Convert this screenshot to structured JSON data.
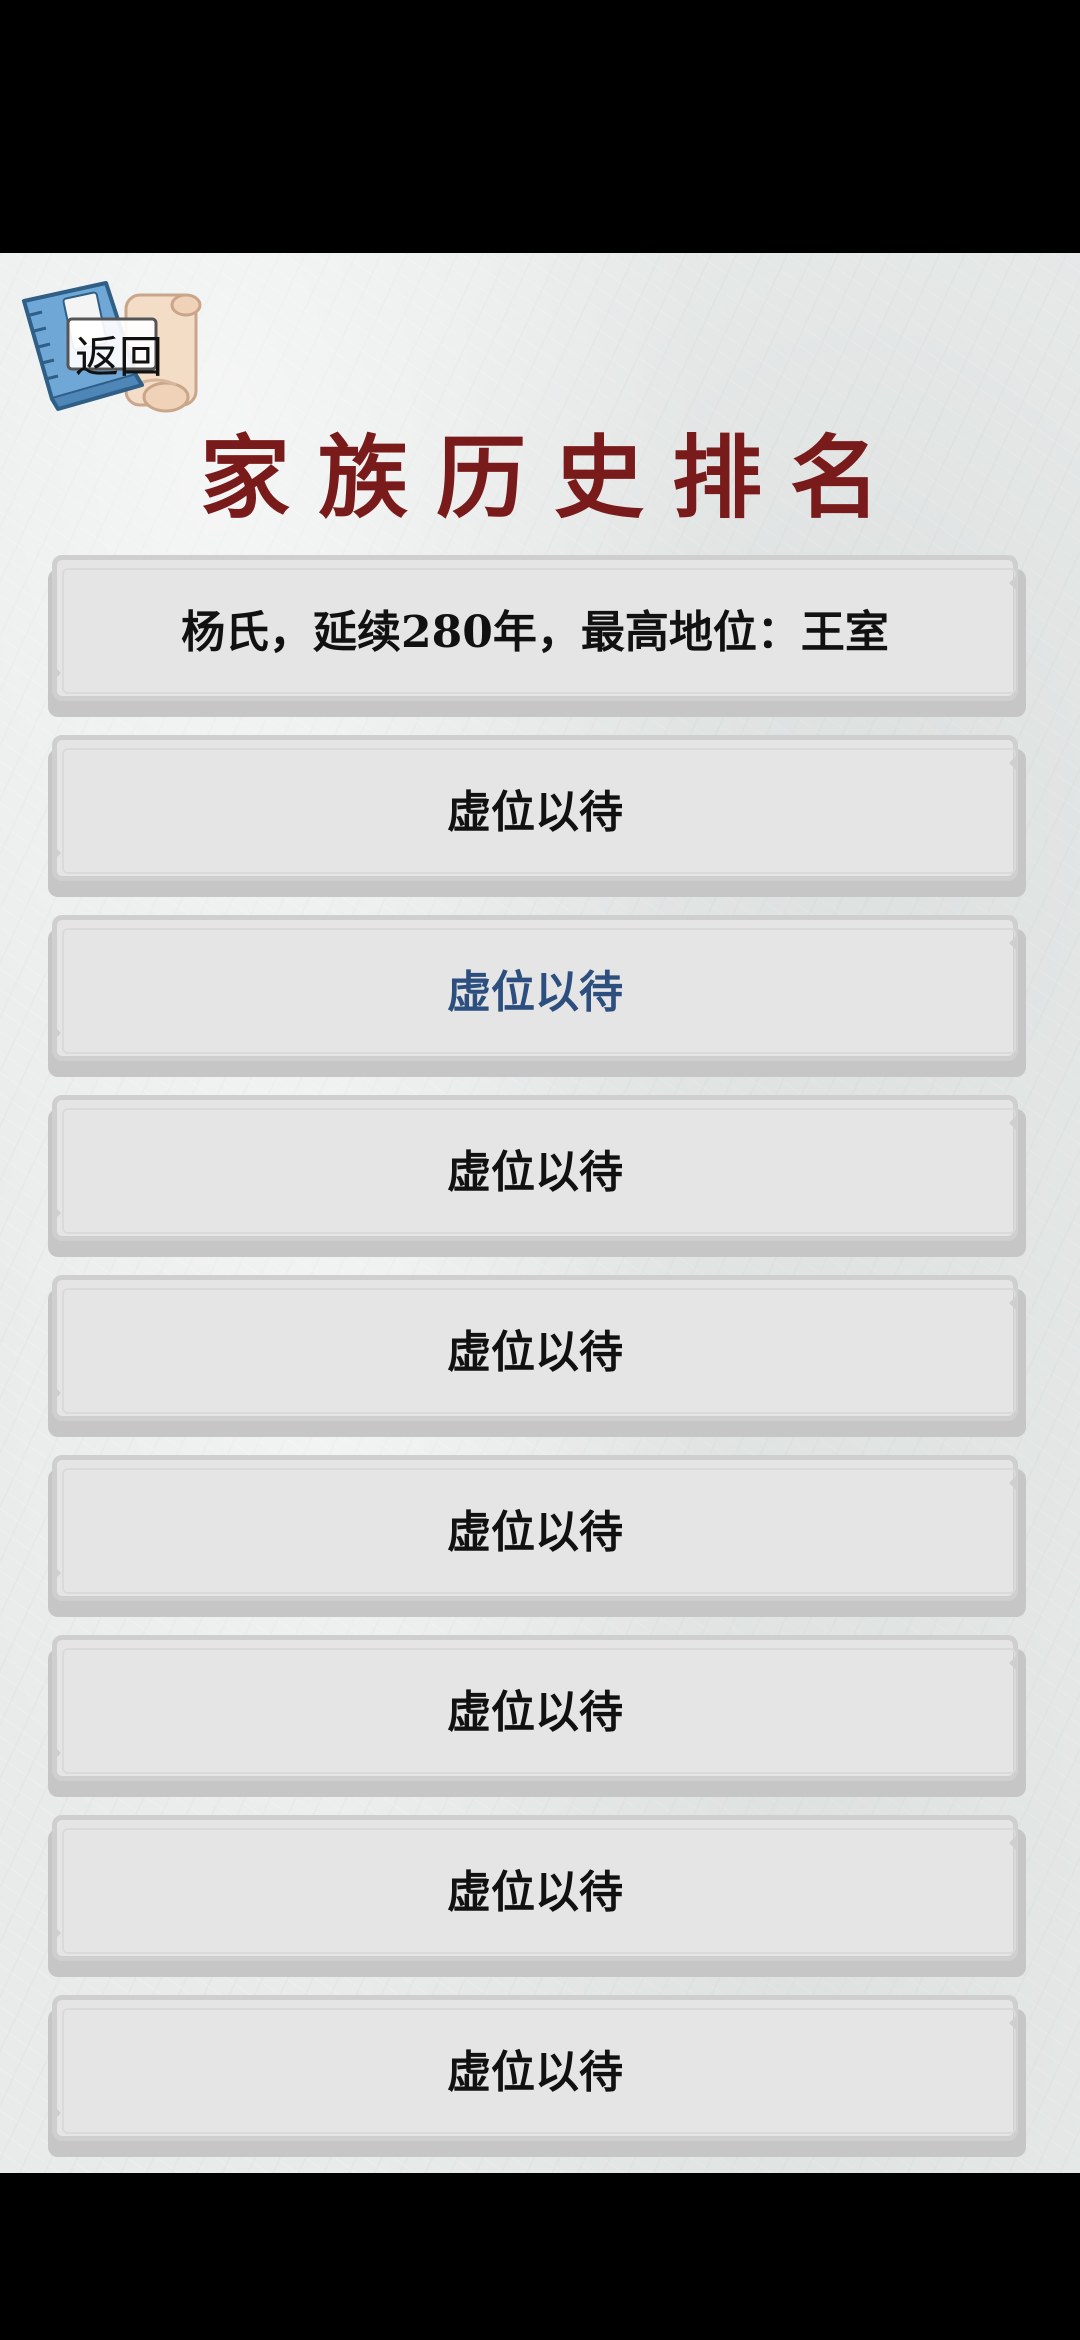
{
  "header": {
    "back_label": "返回",
    "title": "家族历史排名"
  },
  "rankings": [
    {
      "text": "杨氏，延续280年，最高地位：王室",
      "highlight": false
    },
    {
      "text": "虚位以待",
      "highlight": false
    },
    {
      "text": "虚位以待",
      "highlight": true
    },
    {
      "text": "虚位以待",
      "highlight": false
    },
    {
      "text": "虚位以待",
      "highlight": false
    },
    {
      "text": "虚位以待",
      "highlight": false
    },
    {
      "text": "虚位以待",
      "highlight": false
    },
    {
      "text": "虚位以待",
      "highlight": false
    },
    {
      "text": "虚位以待",
      "highlight": false
    }
  ],
  "colors": {
    "title": "#7a1b1b",
    "highlight_text": "#2c4f7f",
    "row_face": "#e5e5e5",
    "paper": "#e8ebea"
  },
  "icons": {
    "back": "book-scroll-icon"
  }
}
